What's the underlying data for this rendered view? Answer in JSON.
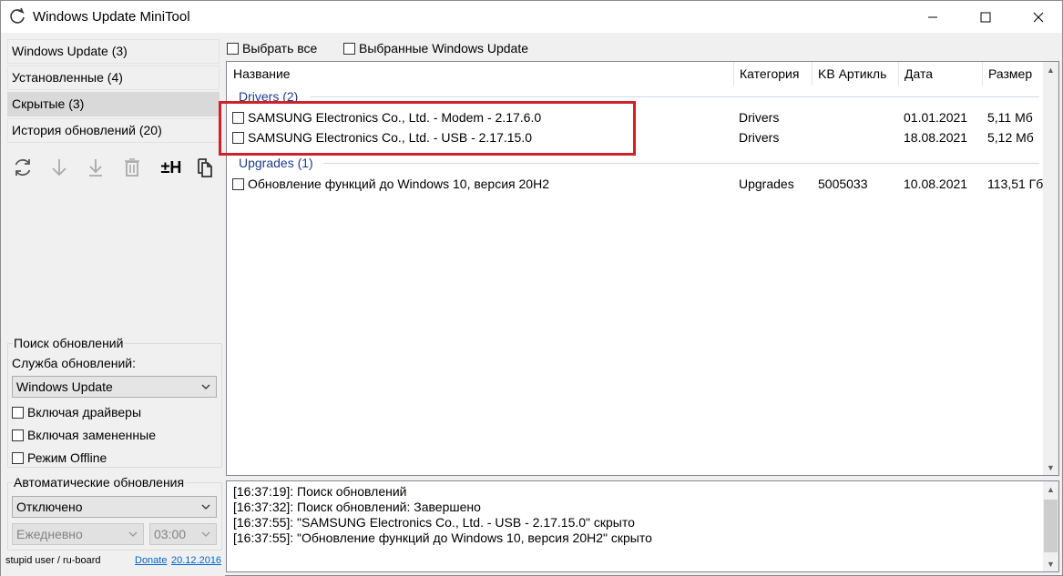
{
  "window": {
    "title": "Windows Update MiniTool"
  },
  "nav": {
    "items": [
      {
        "label": "Windows Update (3)",
        "active": false
      },
      {
        "label": "Установленные (4)",
        "active": false
      },
      {
        "label": "Скрытые (3)",
        "active": true
      },
      {
        "label": "История обновлений (20)",
        "active": false
      }
    ]
  },
  "toolbar": {
    "icons": [
      "refresh-icon",
      "download-icon",
      "install-icon",
      "delete-icon",
      "hide-toggle-icon",
      "copy-icon"
    ],
    "hide_toggle_text": "±H"
  },
  "search_group": {
    "title": "Поиск обновлений",
    "service_label": "Служба обновлений:",
    "service_value": "Windows Update",
    "options": [
      {
        "label": "Включая драйверы",
        "checked": false
      },
      {
        "label": "Включая замененные",
        "checked": false
      },
      {
        "label": "Режим Offline",
        "checked": false
      }
    ]
  },
  "auto_group": {
    "title": "Автоматические обновления",
    "mode_value": "Отключено",
    "frequency_value": "Ежедневно",
    "time_value": "03:00"
  },
  "footer": {
    "credit": "stupid user / ru-board",
    "donate": "Donate",
    "date": "20.12.2016"
  },
  "top_checks": {
    "select_all": "Выбрать все",
    "selected_updates": "Выбранные Windows Update"
  },
  "list": {
    "columns": [
      "Название",
      "Категория",
      "KB Артикль",
      "Дата",
      "Размер"
    ],
    "groups": [
      {
        "header": "Drivers (2)",
        "rows": [
          {
            "name": "SAMSUNG Electronics Co., Ltd.  - Modem - 2.17.6.0",
            "category": "Drivers",
            "kb": "",
            "date": "01.01.2021",
            "size": "5,11 Мб"
          },
          {
            "name": "SAMSUNG Electronics Co., Ltd.  - USB - 2.17.15.0",
            "category": "Drivers",
            "kb": "",
            "date": "18.08.2021",
            "size": "5,12 Мб"
          }
        ]
      },
      {
        "header": "Upgrades (1)",
        "rows": [
          {
            "name": "Обновление функций до Windows 10, версия 20H2",
            "category": "Upgrades",
            "kb": "5005033",
            "date": "10.08.2021",
            "size": "113,51 Гб"
          }
        ]
      }
    ]
  },
  "log": {
    "lines": [
      "[16:37:19]: Поиск обновлений",
      "[16:37:32]: Поиск обновлений: Завершено",
      "[16:37:55]: \"SAMSUNG Electronics Co., Ltd.  - USB - 2.17.15.0\" скрыто",
      "[16:37:55]: \"Обновление функций до Windows 10, версия 20H2\" скрыто"
    ]
  },
  "colors": {
    "group_header": "#1e3c8c",
    "highlight_frame": "#d0202c",
    "link": "#0066cc"
  }
}
